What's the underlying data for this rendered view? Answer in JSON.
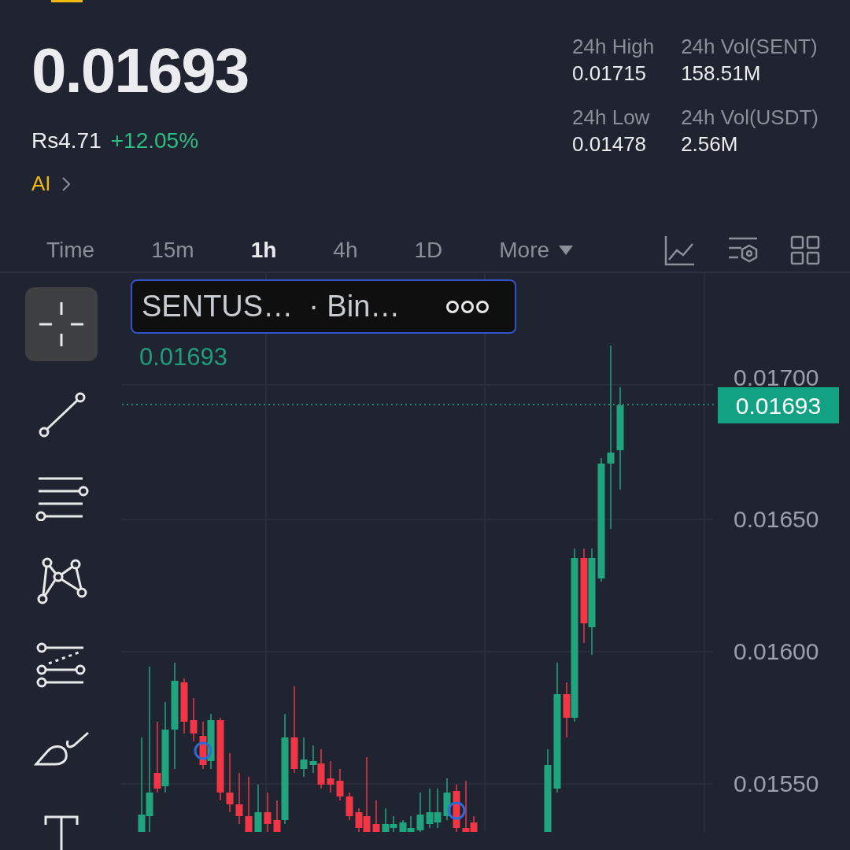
{
  "header": {
    "last_price": "0.01693",
    "fiat_price": "Rs4.71",
    "change": "+12.05%",
    "ai_link": "AI"
  },
  "stats": [
    {
      "label": "24h High",
      "value": "0.01715"
    },
    {
      "label": "24h Vol(SENT)",
      "value": "158.51M"
    },
    {
      "label": "24h Low",
      "value": "0.01478"
    },
    {
      "label": "24h Vol(USDT)",
      "value": "2.56M"
    }
  ],
  "intervals": [
    {
      "label": "Time",
      "selected": false,
      "kind": "interval"
    },
    {
      "label": "15m",
      "selected": false,
      "kind": "interval"
    },
    {
      "label": "1h",
      "selected": true,
      "kind": "interval"
    },
    {
      "label": "4h",
      "selected": false,
      "kind": "interval"
    },
    {
      "label": "1D",
      "selected": false,
      "kind": "interval"
    },
    {
      "label": "More",
      "selected": false,
      "kind": "dropdown"
    }
  ],
  "drawing_tools": [
    {
      "kind": "crosshair",
      "selected": true
    },
    {
      "kind": "trend-line",
      "selected": false
    },
    {
      "kind": "parallel-lines",
      "selected": false
    },
    {
      "kind": "pattern",
      "selected": false
    },
    {
      "kind": "fib",
      "selected": false
    },
    {
      "kind": "brush",
      "selected": false
    },
    {
      "kind": "text",
      "selected": false
    }
  ],
  "chart": {
    "legend": {
      "symbol": "SENTUS…",
      "exchange": "· Bin…"
    },
    "legend_price": "0.01693",
    "y_axis_labels": [
      "0.01700",
      "0.01650",
      "0.01600",
      "0.01550"
    ],
    "current_price_tag": "0.01693"
  }
}
